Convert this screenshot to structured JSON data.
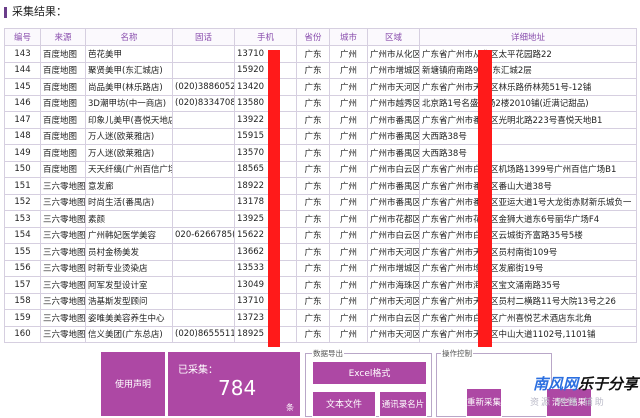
{
  "title": "采集结果：",
  "columns": [
    "编号",
    "来源",
    "名称",
    "固话",
    "手机",
    "省份",
    "城市",
    "区域",
    "详细地址"
  ],
  "rows": [
    [
      "143",
      "百度地图",
      "芭花美甲",
      "",
      "13710",
      "广东",
      "广州",
      "广州市从化区",
      "广东省广州市从化区太平花园路22"
    ],
    [
      "144",
      "百度地图",
      "聚贤美甲(东汇城店)",
      "",
      "15920",
      "广东",
      "广州",
      "广州市增城区",
      "新塘镇府南路98号东汇城2层"
    ],
    [
      "145",
      "百度地图",
      "尚品美甲(林乐路店)",
      "(020)3886052",
      "13420",
      "广东",
      "广州",
      "广州市天河区",
      "广东省广州市天河区林乐路侨林苑51号-12铺"
    ],
    [
      "146",
      "百度地图",
      "3D潮甲坊(中一商店)",
      "(020)8334708",
      "13580",
      "广东",
      "广州",
      "广州市越秀区",
      "北京路1号名盛广场2楼2010铺(近满记甜品)"
    ],
    [
      "147",
      "百度地图",
      "印象儿美甲(喜悦天地店)",
      "",
      "13922",
      "广东",
      "广州",
      "广州市番禺区",
      "广东省广州市番禺区光明北路223号喜悦天地B1"
    ],
    [
      "148",
      "百度地图",
      "万人迷(欧莱雅店)",
      "",
      "15915",
      "广东",
      "广州",
      "广州市番禺区",
      "大西路38号"
    ],
    [
      "149",
      "百度地图",
      "万人迷(欧莱雅店)",
      "",
      "13570",
      "广东",
      "广州",
      "广州市番禺区",
      "大西路38号"
    ],
    [
      "150",
      "百度地图",
      "天天纤缡(广州百信广场",
      "",
      "18565",
      "广东",
      "广州",
      "广州市白云区",
      "广东省广州市白云区机场路1399号广州百信广场B1"
    ],
    [
      "151",
      "三六零地图",
      "意发廊",
      "",
      "18922",
      "广东",
      "广州",
      "广州市番禺区",
      "广东省广州市番禺区番山大道38号"
    ],
    [
      "152",
      "三六零地图",
      "时尚生活(番禺店)",
      "",
      "13178",
      "广东",
      "广州",
      "广州市番禺区",
      "广东省广州市番禺区亚运大道1号大龙街赤财新乐城负一"
    ],
    [
      "153",
      "三六零地图",
      "素颜",
      "",
      "13925",
      "广东",
      "广州",
      "广州市花都区",
      "广东省广州市花都区金狮大道东6号丽华广场F4"
    ],
    [
      "154",
      "三六零地图",
      "广州韩妃医学美容",
      "020-6266785(",
      "15622",
      "广东",
      "广州",
      "广州市白云区",
      "广东省广州市白云区云城街齐富路35号5楼"
    ],
    [
      "155",
      "三六零地图",
      "员村金杨美发",
      "",
      "13662",
      "广东",
      "广州",
      "广州市天河区",
      "广东省广州市天河区员村南街109号"
    ],
    [
      "156",
      "三六零地图",
      "时新专业烫染店",
      "",
      "13533",
      "广东",
      "广州",
      "广州市增城区",
      "广东省广州市增城区发廊街19号"
    ],
    [
      "157",
      "三六零地图",
      "阿军发型设计室",
      "",
      "13049",
      "广东",
      "广州",
      "广州市海珠区",
      "广东省广州市海珠区宝文涌南路35号"
    ],
    [
      "158",
      "三六零地图",
      "浩基斯发型顾问",
      "",
      "13710",
      "广东",
      "广州",
      "广州市天河区",
      "广东省广州市天河区员村二横路11号大院13号之26"
    ],
    [
      "159",
      "三六零地图",
      "姿唯美美容养生中心",
      "",
      "13723",
      "广东",
      "广州",
      "广州市白云区",
      "广东省广州市白云区广州喜悦艺术酒店东北角"
    ],
    [
      "160",
      "三六零地图",
      "信义美团(广东总店)",
      "(020)8655511",
      "18925",
      "广东",
      "广州",
      "广州市天河区",
      "广东省广州市天河区中山大道1102号,1101铺"
    ]
  ],
  "stats": {
    "usage_label": "使用声明",
    "collected_label": "已采集：",
    "count": "784",
    "unit": "条"
  },
  "export": {
    "group_label": "数据导出",
    "excel": "Excel格式",
    "text": "文本文件",
    "vcard": "通讯录名片"
  },
  "ops": {
    "group_label": "操作控制",
    "restart": "重新采集",
    "clear": "清空结果"
  },
  "watermark": {
    "brand_blue": "南风网",
    "brand_black": "乐于分享",
    "sub": "资源 网赚 辅助"
  }
}
